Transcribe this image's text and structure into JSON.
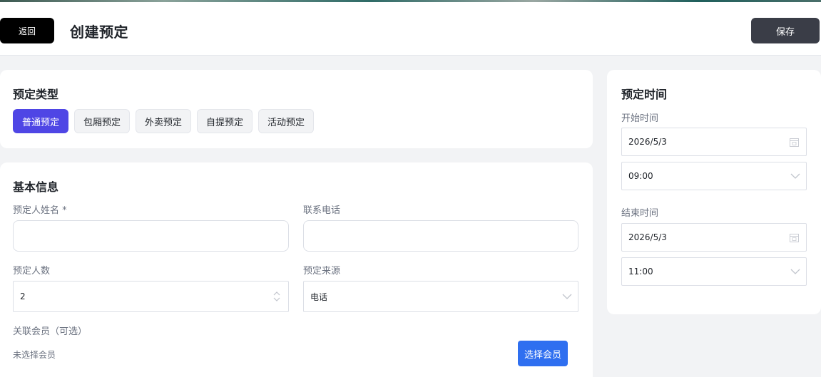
{
  "header": {
    "back_label": "返回",
    "title": "创建预定",
    "save_label": "保存"
  },
  "reservation_type": {
    "title": "预定类型",
    "options": [
      "普通预定",
      "包厢预定",
      "外卖预定",
      "自提预定",
      "活动预定"
    ],
    "selected": "普通预定"
  },
  "basic_info": {
    "title": "基本信息",
    "name_label": "预定人姓名 *",
    "name_value": "",
    "phone_label": "联系电话",
    "phone_value": "",
    "guests_label": "预定人数",
    "guests_value": "2",
    "source_label": "预定来源",
    "source_value": "电话",
    "member_label": "关联会员（可选）",
    "member_empty": "未选择会员",
    "select_member_label": "选择会员"
  },
  "time": {
    "title": "预定时间",
    "start_label": "开始时间",
    "start_date": "2026/5/3",
    "start_time": "09:00",
    "end_label": "结束时间",
    "end_date": "2026/5/3",
    "end_time": "11:00"
  },
  "colors": {
    "primary": "#4f46e5",
    "member_button": "#2f6ff0",
    "save_button": "#3a3d47",
    "back_button": "#000000"
  }
}
